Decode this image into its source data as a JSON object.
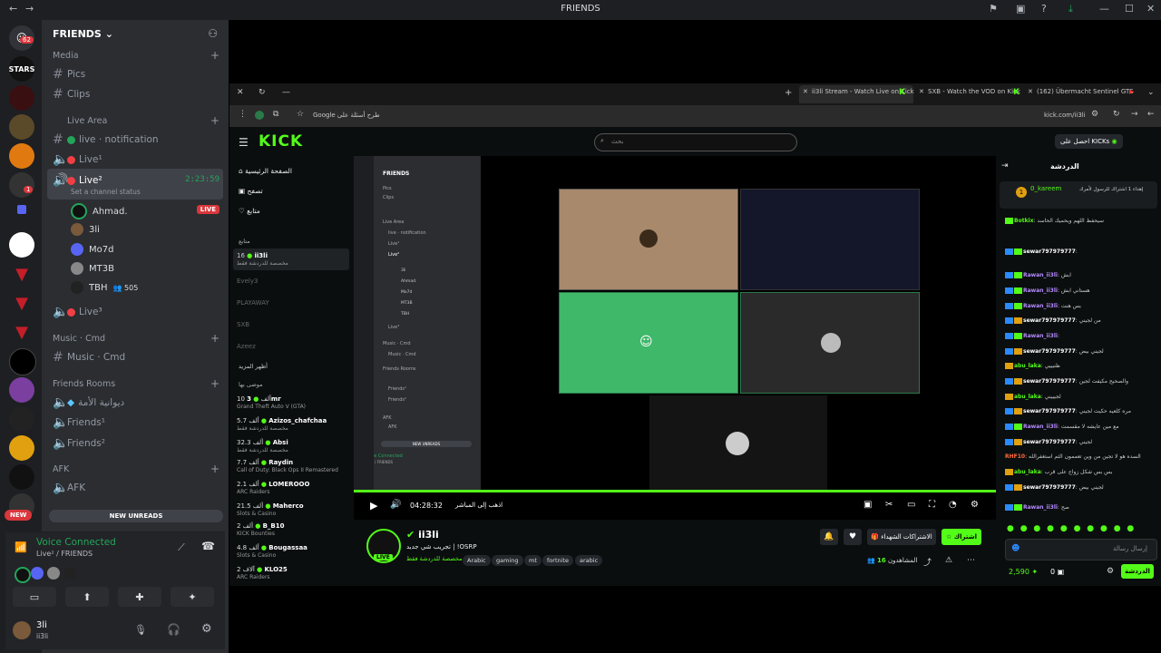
{
  "window_title": "FRIENDS",
  "server_badges": {
    "home": "62",
    "unread": "1",
    "new": "NEW"
  },
  "servers": [
    "STARS"
  ],
  "guild": {
    "name": "FRIENDS"
  },
  "categories": {
    "media": "Media",
    "live_area": "Live Area",
    "music": "Music · Cmd",
    "friends_rooms": "Friends Rooms",
    "afk": "AFK"
  },
  "channels": {
    "pics": "Pics",
    "clips": "Clips",
    "notification": "live · notification",
    "live1": "Live¹",
    "live2": "Live²",
    "live2_timer": "2:23:59",
    "status": "Set a channel status",
    "live3": "Live³",
    "music": "Music · Cmd",
    "diwaniya": "ديوانية الأمة",
    "friends1": "Friends¹",
    "friends2": "Friends²",
    "afk": "AFK"
  },
  "voice_users": [
    {
      "name": "Ahmad.",
      "live": "LIVE"
    },
    {
      "name": "3li"
    },
    {
      "name": "Mo7d"
    },
    {
      "name": "MT3B"
    },
    {
      "name": "TBH",
      "count": "505"
    }
  ],
  "new_unreads": "NEW UNREADS",
  "voice_panel": {
    "status": "Voice Connected",
    "channel": "Live² / FRIENDS"
  },
  "user": {
    "name": "3li",
    "tag": "ii3li"
  },
  "browser": {
    "tabs": [
      "ii3li Stream - Watch Live on Kick",
      "SXB - Watch the VOD on Kick",
      "(162) Übermacht Sentinel GTS"
    ],
    "url": "kick.com/ii3li",
    "google_bookmark": "Google طرح أسئلة على"
  },
  "kick": {
    "logo": "KICK",
    "search_placeholder": "بحث",
    "get_kicks": "احصل على KICKs",
    "nav": [
      "الصفحة الرئيسية",
      "تصفح",
      "متابع"
    ],
    "following_label": "متابع",
    "show_more": "أظهر المزيد",
    "recommended_label": "موصى بها",
    "following": [
      {
        "count": "16",
        "name": "ii3li",
        "sub": "مخصصة للدردشة فقط"
      },
      {
        "name": "Evely3"
      },
      {
        "name": "PLAYAWAY"
      },
      {
        "name": "SXB"
      },
      {
        "name": "Azeez"
      }
    ],
    "recommended": [
      {
        "count": "10 ألف",
        "name": "3mr",
        "sub": "Grand Theft Auto V (GTA)"
      },
      {
        "count": "5.7 ألف",
        "name": "Azizos_chafchaa",
        "sub": "مخصصة للدردشة فقط"
      },
      {
        "count": "32.3 ألف",
        "name": "Absi",
        "sub": "مخصصة للدردشة فقط"
      },
      {
        "count": "7.7 ألف",
        "name": "Raydin",
        "sub": "Call of Duty: Black Ops II Remastered"
      },
      {
        "count": "2.1 ألف",
        "name": "LOMEROOO",
        "sub": "ARC Raiders"
      },
      {
        "count": "21.5 ألف",
        "name": "Maherco",
        "sub": "Slots & Casino"
      },
      {
        "count": "2 ألف",
        "name": "B_B10",
        "sub": "KICK Bounties"
      },
      {
        "count": "4.8 ألف",
        "name": "Bougassaa",
        "sub": "Slots & Casino"
      },
      {
        "count": "2 آلاف",
        "name": "KLO25",
        "sub": "ARC Raiders"
      }
    ],
    "player": {
      "time": "04:28:32",
      "go_live": "اذهب إلى المباشر"
    },
    "streamer": {
      "name": "ii3li",
      "title": "تجريب شي جديد | !OSRP",
      "category": "مخصصة للدردشة فقط",
      "tags": [
        "Arabic",
        "gaming",
        "mt",
        "fortnite",
        "arabic"
      ],
      "live_badge": "LIVE",
      "viewers": "16",
      "viewers_label": "المشاهدون"
    },
    "subscribe": "اشتراك",
    "gift_subs": "الاشتراكات الشهداء",
    "chat": {
      "title": "الدردشة",
      "pinned_user": "0_kareem",
      "pinned_text": "إهداء 1 اشتراك للرسول لأمرك",
      "messages": [
        {
          "user": "Botkix",
          "text": "سيحفظ اللهم ويحميك الحاسد"
        },
        {
          "user": "sewar797979777",
          "text": ""
        },
        {
          "user": "Rawan_ii3li",
          "text": "ابش"
        },
        {
          "user": "Rawan_ii3li",
          "text": "هستاني ابش"
        },
        {
          "user": "Rawan_ii3li",
          "text": "بس هنت"
        },
        {
          "user": "sewar797979777",
          "text": "من لجيني"
        },
        {
          "user": "Rawan_ii3li",
          "text": ""
        },
        {
          "user": "sewar797979777",
          "text": "لجيني بيض"
        },
        {
          "user": "abu_laka",
          "text": "ظنيييي"
        },
        {
          "user": "sewar797979777",
          "text": "والصحيح مكيفت لجين"
        },
        {
          "user": "abu_laka",
          "text": "لجيييني"
        },
        {
          "user": "sewar797979777",
          "text": "مره كلعيه حكيت لجيني"
        },
        {
          "user": "Rawan_ii3li",
          "text": "مع مين عايشه لا مقسمت"
        },
        {
          "user": "sewar797979777",
          "text": "لجيني"
        },
        {
          "user": "RHF10",
          "text": "السده هو لا تجين من وين تعممون الثم استغفرالله"
        },
        {
          "user": "abu_laka",
          "text": "بس بس شكل زواج على قرب"
        },
        {
          "user": "sewar797979777",
          "text": "لجيني بيض"
        },
        {
          "user": "Rawan_ii3li",
          "text": "صح"
        }
      ],
      "placeholder": "إرسال رسالة",
      "points": "2,590",
      "zero": "0",
      "chat_button": "الدردشة"
    }
  },
  "inner_discord": {
    "title": "FRIENDS",
    "channels": [
      "Pics",
      "Clips",
      "Live Area",
      "live · notification",
      "Live¹",
      "Live²",
      "3li",
      "Ahmad.",
      "Mo7d",
      "MT3B",
      "TBH",
      "Live³",
      "Music · Cmd",
      "Music · Cmd",
      "Friends Rooms",
      "Friends¹",
      "Friends²",
      "AFK",
      "AFK"
    ],
    "voice_connected": "Voice Connected",
    "voice_channel": "Live² / FRIENDS",
    "new_unreads": "NEW UNREADS"
  },
  "colors": {
    "kick_green": "#53fc18",
    "discord_bg": "#2b2d31",
    "live_red": "#da373c",
    "voice_green": "#23a55a"
  }
}
